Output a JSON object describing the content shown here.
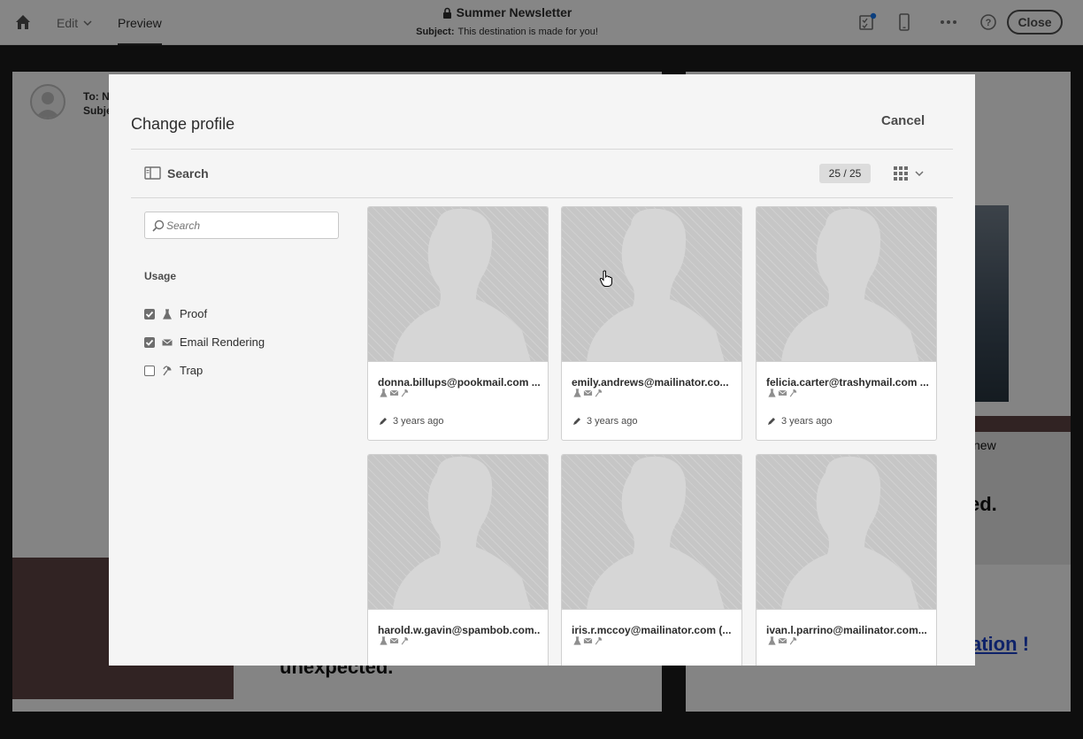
{
  "topbar": {
    "edit_label": "Edit",
    "preview_label": "Preview",
    "title": "Summer Newsletter",
    "subject_label": "Subject:",
    "subject_value": "This destination is made for you!",
    "close_label": "Close"
  },
  "background": {
    "to_line": "To: N",
    "subject_line": "Subje",
    "right_dot_top": ".",
    "right_new": "new",
    "right_ed": "ed.",
    "right_dot": ".",
    "right_link": "ation",
    "right_bang": "!",
    "left_unexpected": "unexpected."
  },
  "modal": {
    "title": "Change profile",
    "cancel_label": "Cancel",
    "search_panel_label": "Search",
    "count": "25 / 25",
    "search_placeholder": "Search",
    "usage_title": "Usage",
    "filters": [
      {
        "label": "Proof",
        "checked": true,
        "icon": "flask-icon"
      },
      {
        "label": "Email Rendering",
        "checked": true,
        "icon": "envelope-icon"
      },
      {
        "label": "Trap",
        "checked": false,
        "icon": "trap-icon"
      }
    ]
  },
  "profiles": [
    {
      "email": "donna.billups@pookmail.com ...",
      "edited": "3 years ago"
    },
    {
      "email": "emily.andrews@mailinator.co...",
      "edited": "3 years ago"
    },
    {
      "email": "felicia.carter@trashymail.com ...",
      "edited": "3 years ago"
    },
    {
      "email": "harold.w.gavin@spambob.com...",
      "edited": ""
    },
    {
      "email": "iris.r.mccoy@mailinator.com (...",
      "edited": ""
    },
    {
      "email": "ivan.l.parrino@mailinator.com...",
      "edited": ""
    }
  ],
  "colors": {
    "accent": "#2c2c2c",
    "modal_bg": "#f5f5f5",
    "link": "#1a3fc0"
  }
}
